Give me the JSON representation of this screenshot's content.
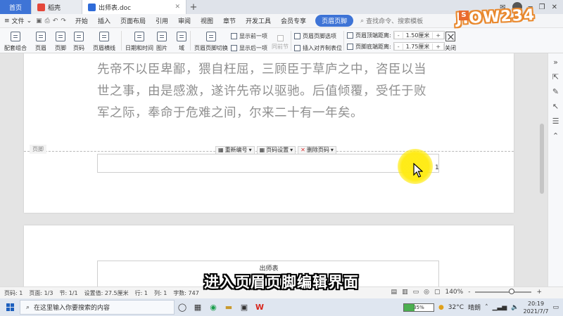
{
  "tabs": [
    {
      "label": "首页"
    },
    {
      "label": "稻壳"
    },
    {
      "label": "出师表.doc"
    }
  ],
  "menu": {
    "file": "文件",
    "items": [
      "开始",
      "插入",
      "页面布局",
      "引用",
      "审阅",
      "视图",
      "章节",
      "开发工具",
      "会员专享"
    ],
    "active": "页眉页脚",
    "search_placeholder": "查找命令、搜索模板"
  },
  "ribbon": {
    "buttons": [
      "配套组合",
      "页眉",
      "页脚",
      "页码",
      "页眉横线",
      "日期和时间",
      "图片",
      "域",
      "页眉页脚切换"
    ],
    "show_prev": "显示前一项",
    "show_next": "显示后一项",
    "same_as_prev": "同前节",
    "options": "页眉页脚选项",
    "insert_align_tab": "插入对齐制表位",
    "header_top_label": "页眉顶端距离:",
    "header_top_value": "1.50厘米",
    "footer_bottom_label": "页脚底端距离:",
    "footer_bottom_value": "1.75厘米",
    "minus": "-",
    "plus": "+",
    "close": "关闭"
  },
  "logo": {
    "text": "JIOW234",
    "badge": "S"
  },
  "document": {
    "lines": [
      "先帝不以臣卑鄙，猥自枉屈，三顾臣于草庐之中，咨臣以当",
      "世之事，由是感激，遂许先帝以驱驰。后值倾覆，受任于败",
      "军之际，奉命于危难之间，尔来二十有一年矣。"
    ],
    "footer_label": "页脚",
    "footer_tools": [
      "重新编号",
      "页码设置",
      "删除页码"
    ],
    "page_number": "1",
    "page2_header": "出师表"
  },
  "caption": "进入页眉页脚编辑界面",
  "status": {
    "page": "页码: 1",
    "pages": "页面: 1/3",
    "section": "节: 1/1",
    "setting": "设置值: 27.5厘米",
    "row": "行: 1",
    "col": "列: 1",
    "words": "字数: 747",
    "zoom": "140%",
    "minus": "-",
    "plus": "+"
  },
  "taskbar": {
    "search_placeholder": "在这里输入你要搜索的内容",
    "battery": "35%",
    "battery_level": 0.35,
    "temperature": "32°C",
    "weather": "晴朗",
    "time": "20:19",
    "date": "2021/7/7"
  },
  "colors": {
    "accent": "#3e74d6",
    "highlight": "#ffeb14",
    "logo": "#e9892e"
  }
}
